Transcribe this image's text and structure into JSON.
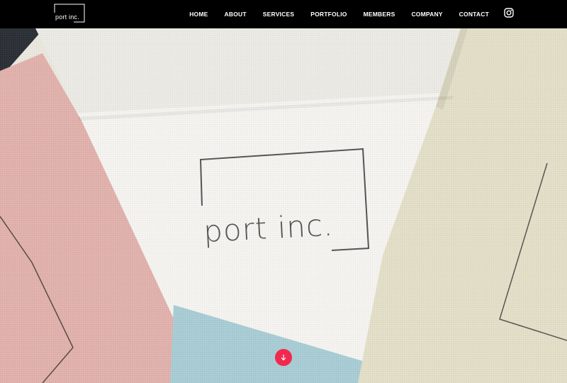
{
  "brand": {
    "logo_text": "port inc."
  },
  "nav": {
    "items": [
      {
        "label": "HOME"
      },
      {
        "label": "ABOUT"
      },
      {
        "label": "SERVICES"
      },
      {
        "label": "PORTFOLIO"
      },
      {
        "label": "MEMBERS"
      },
      {
        "label": "COMPANY"
      },
      {
        "label": "CONTACT"
      }
    ]
  },
  "hero": {
    "label_text": "port inc."
  },
  "icons": {
    "social": "instagram-icon",
    "scroll": "arrow-down-icon"
  },
  "colors": {
    "nav_background": "#000000",
    "scroll_button": "#f2284e",
    "pink_fabric": "#e2b2ad",
    "white_fabric": "#f4f3ef",
    "beige_fabric": "#e4dfc8",
    "blue_fabric": "#a9cdd6"
  }
}
